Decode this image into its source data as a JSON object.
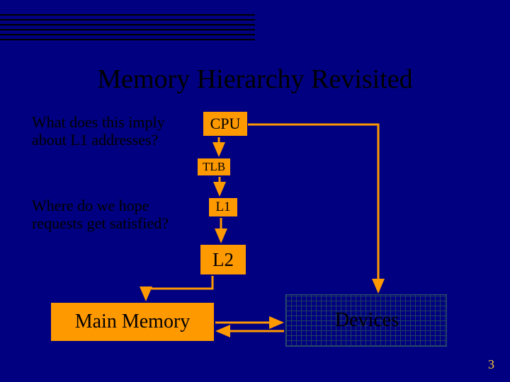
{
  "title": "Memory Hierarchy Revisited",
  "questions": {
    "q1": "What does this imply about L1 addresses?",
    "q2": "Where do we hope requests get satisfied?"
  },
  "boxes": {
    "cpu": "CPU",
    "tlb": "TLB",
    "l1": "L1",
    "l2": "L2",
    "main_memory": "Main Memory",
    "devices": "Devices"
  },
  "page_number": "3",
  "colors": {
    "bg": "#000080",
    "box_fill": "#ff9900",
    "accent": "#ffcc33"
  }
}
